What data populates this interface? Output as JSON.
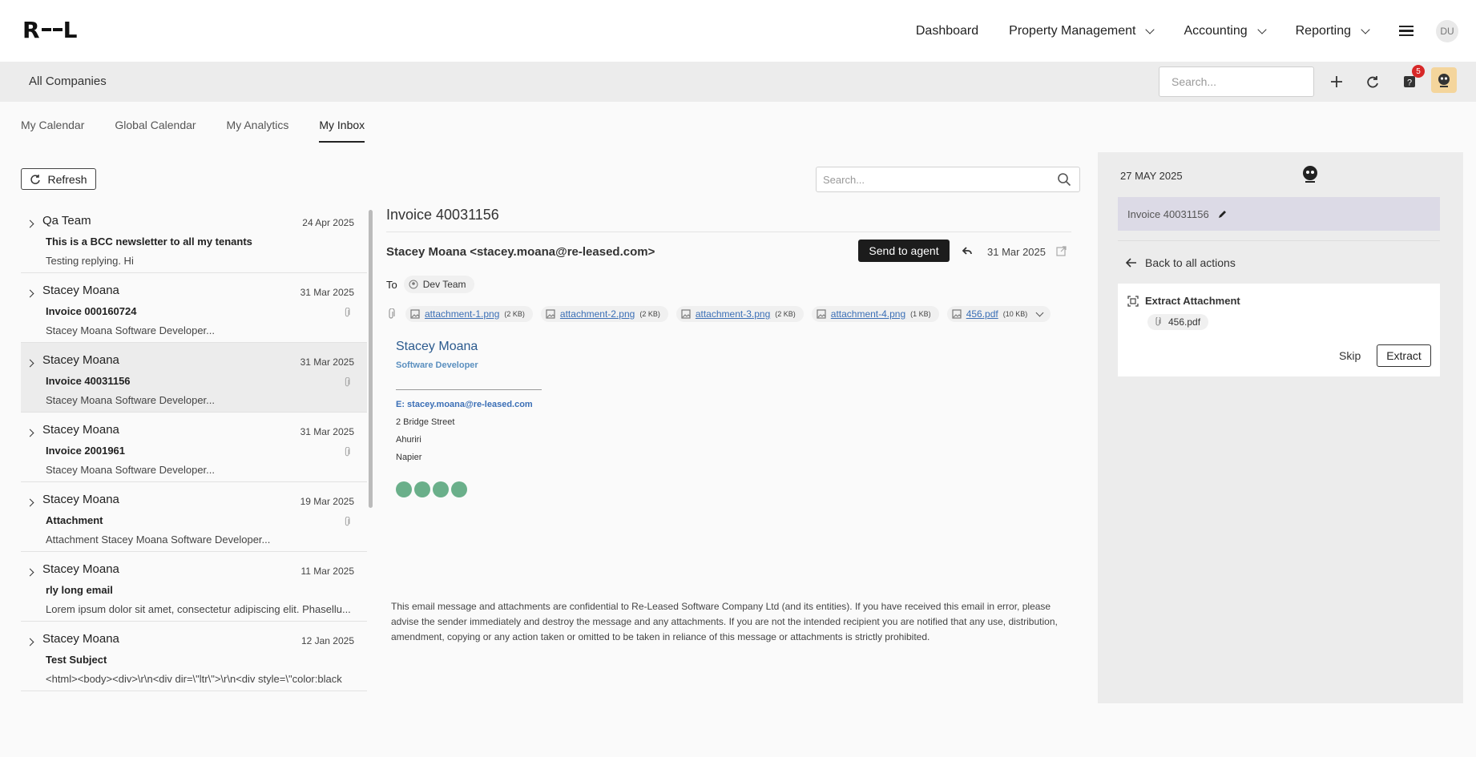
{
  "app": {
    "logo": "R--L"
  },
  "nav": {
    "items": [
      {
        "label": "Dashboard",
        "dropdown": false
      },
      {
        "label": "Property Management",
        "dropdown": true
      },
      {
        "label": "Accounting",
        "dropdown": true
      },
      {
        "label": "Reporting",
        "dropdown": true
      }
    ],
    "user_initials": "DU"
  },
  "subbar": {
    "company": "All Companies",
    "search_placeholder": "Search...",
    "notification_count": "5"
  },
  "tabs": [
    "My Calendar",
    "Global Calendar",
    "My Analytics",
    "My Inbox"
  ],
  "active_tab": "My Inbox",
  "inbox": {
    "refresh_label": "Refresh",
    "search_placeholder": "Search...",
    "messages": [
      {
        "sender": "Qa Team",
        "date": "24 Apr 2025",
        "subject": "This is a BCC newsletter to all my tenants",
        "preview": "Testing replying. Hi",
        "attachment": false,
        "selected": false
      },
      {
        "sender": "Stacey Moana",
        "date": "31 Mar 2025",
        "subject": "Invoice 000160724",
        "preview": "Stacey Moana Software Developer...",
        "attachment": true,
        "selected": false
      },
      {
        "sender": "Stacey Moana",
        "date": "31 Mar 2025",
        "subject": "Invoice 40031156",
        "preview": "Stacey Moana Software Developer...",
        "attachment": true,
        "selected": true
      },
      {
        "sender": "Stacey Moana",
        "date": "31 Mar 2025",
        "subject": "Invoice 2001961",
        "preview": "Stacey Moana Software Developer...",
        "attachment": true,
        "selected": false
      },
      {
        "sender": "Stacey Moana",
        "date": "19 Mar 2025",
        "subject": "Attachment",
        "preview": "Attachment Stacey Moana Software Developer...",
        "attachment": true,
        "selected": false
      },
      {
        "sender": "Stacey Moana",
        "date": "11 Mar 2025",
        "subject": "rly long email",
        "preview": "Lorem ipsum dolor sit amet, consectetur adipiscing elit. Phasellu...",
        "attachment": false,
        "selected": false
      },
      {
        "sender": "Stacey Moana",
        "date": "12 Jan 2025",
        "subject": "Test Subject",
        "preview": "<html><body><div>\\r\\n<div dir=\\\"ltr\\\">\\r\\n<div style=\\\"color:black",
        "attachment": false,
        "selected": false
      }
    ]
  },
  "mail": {
    "title": "Invoice 40031156",
    "from": "Stacey Moana <stacey.moana@re-leased.com>",
    "send_to_agent": "Send to agent",
    "date": "31 Mar 2025",
    "to_label": "To",
    "to": "Dev Team",
    "attachments": [
      {
        "name": "attachment-1.png",
        "size": "(2 KB)"
      },
      {
        "name": "attachment-2.png",
        "size": "(2 KB)"
      },
      {
        "name": "attachment-3.png",
        "size": "(2 KB)"
      },
      {
        "name": "attachment-4.png",
        "size": "(1 KB)"
      },
      {
        "name": "456.pdf",
        "size": "(10 KB)"
      }
    ],
    "signature": {
      "name": "Stacey Moana",
      "role": "Software Developer",
      "email": "E: stacey.moana@re-leased.com",
      "address": [
        "2 Bridge Street",
        "Ahuriri",
        "Napier"
      ]
    },
    "disclaimer": "This email message and attachments are confidential to Re-Leased Software Company Ltd (and its entities). If you have received this email in error, please advise the sender immediately and destroy the message and any attachments. If you are not the intended recipient you are notified that any use, distribution, amendment, copying or any action taken or omitted to be taken in reliance of this message or attachments is strictly prohibited."
  },
  "panel": {
    "date": "27 MAY 2025",
    "invoice": "Invoice 40031156",
    "back": "Back to all actions",
    "action_title": "Extract Attachment",
    "file": "456.pdf",
    "skip": "Skip",
    "extract": "Extract"
  }
}
